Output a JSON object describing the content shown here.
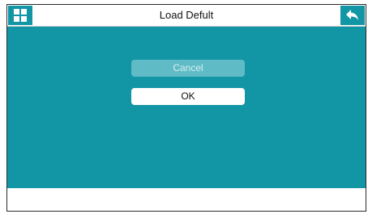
{
  "window": {
    "title": "Load Defult"
  },
  "dialog": {
    "cancel_label": "Cancel",
    "ok_label": "OK"
  },
  "colors": {
    "accent": "#1296a6",
    "cancel_button": "#5fbcc6",
    "ok_button": "#ffffff"
  },
  "icons": {
    "menu": "grid-icon",
    "back": "back-arrow-icon"
  }
}
